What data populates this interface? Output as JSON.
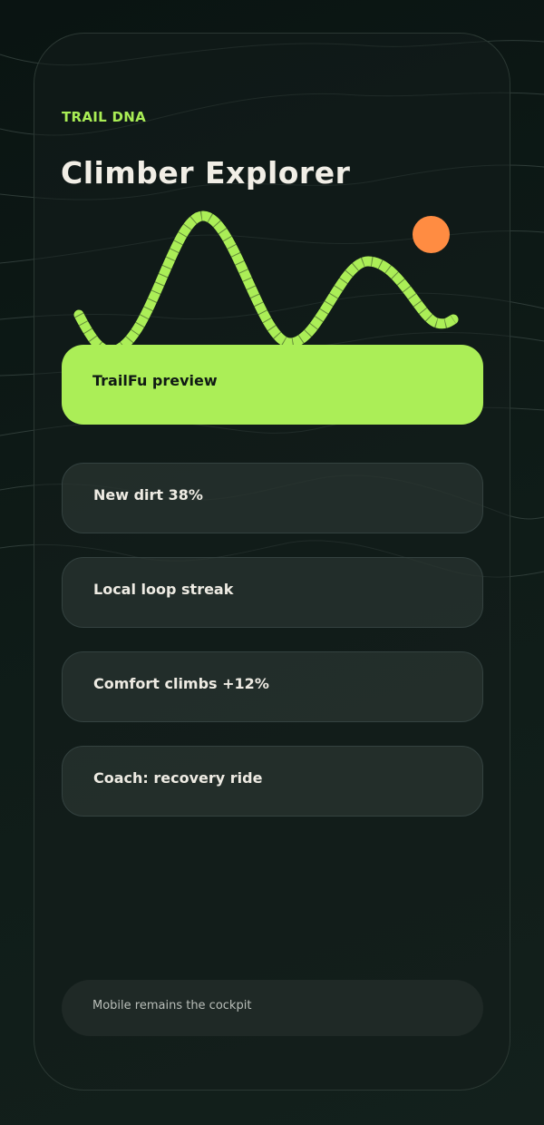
{
  "header": {
    "eyebrow": "TRAIL DNA",
    "title": "Climber Explorer"
  },
  "profile": {
    "wave_color": "#abee57",
    "sun_color": "#ff8c42"
  },
  "primary_card": {
    "label": "TrailFu preview",
    "color": "#abee57"
  },
  "stats": [
    {
      "label": "New dirt 38%"
    },
    {
      "label": "Local loop streak"
    },
    {
      "label": "Comfort climbs +12%"
    },
    {
      "label": "Coach: recovery ride"
    }
  ],
  "footer": {
    "note": "Mobile remains the cockpit"
  }
}
